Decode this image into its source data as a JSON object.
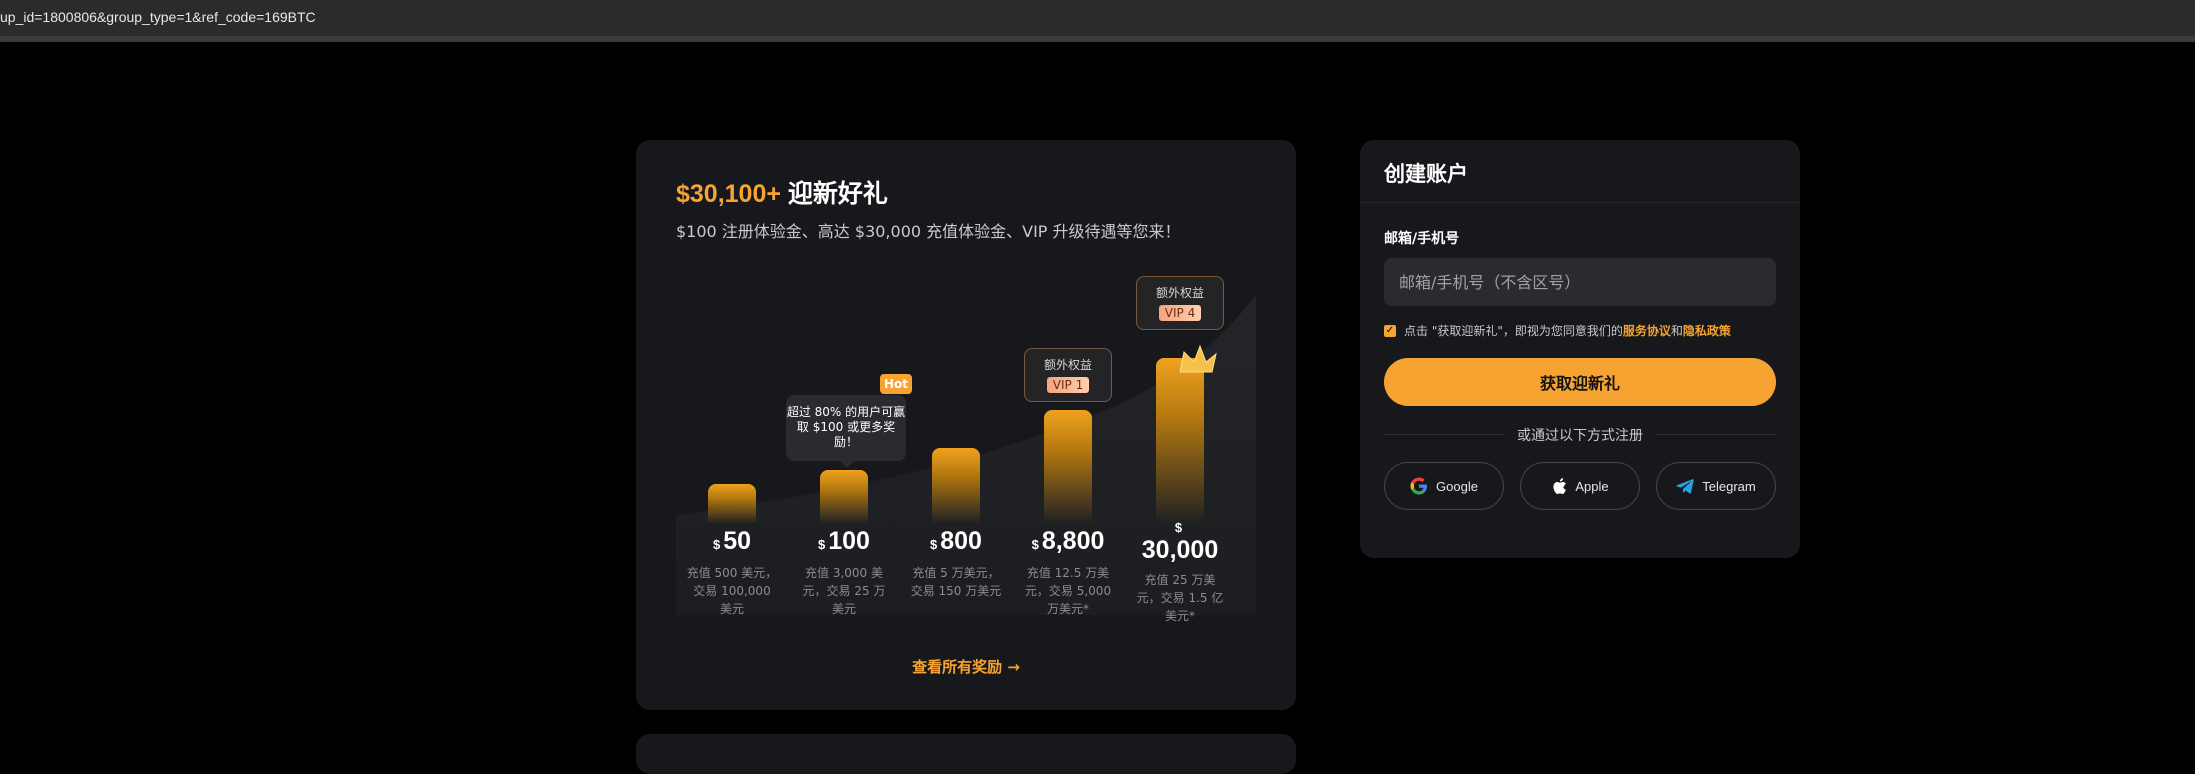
{
  "browser": {
    "url_fragment": "up_id=1800806&group_type=1&ref_code=169BTC"
  },
  "promo": {
    "title_amount": "$30,100+",
    "title_rest": " 迎新好礼",
    "subtitle": "$100 注册体验金、高达 $30,000 充值体验金、VIP 升级待遇等您来！",
    "hot_tooltip": "超过 80% 的用户可赢取 $100 或更多奖励！",
    "hot_badge": "Hot",
    "extra_label": "额外权益",
    "tiers": [
      {
        "currency": "$",
        "amount": "50",
        "desc": "充值 500 美元，交易 100,000 美元"
      },
      {
        "currency": "$",
        "amount": "100",
        "desc": "充值 3,000 美元，交易 25 万美元"
      },
      {
        "currency": "$",
        "amount": "800",
        "desc": "充值 5 万美元，交易 150 万美元"
      },
      {
        "currency": "$",
        "amount": "8,800",
        "desc": "充值 12.5 万美元，交易 5,000 万美元*"
      },
      {
        "currency": "$",
        "amount": "30,000",
        "desc": "充值 25 万美元，交易 1.5 亿美元*"
      }
    ],
    "vip_badges": [
      "VIP 1",
      "VIP 4"
    ],
    "view_all": "查看所有奖励 →"
  },
  "signup": {
    "title": "创建账户",
    "field_label": "邮箱/手机号",
    "field_placeholder": "邮箱/手机号（不含区号）",
    "agree_prefix": "点击 \"获取迎新礼\"，即视为您同意我们的",
    "terms_link": "服务协议",
    "and": "和",
    "privacy_link": "隐私政策",
    "cta": "获取迎新礼",
    "or_text": "或通过以下方式注册",
    "socials": [
      {
        "label": "Google",
        "icon": "google-icon"
      },
      {
        "label": "Apple",
        "icon": "apple-icon"
      },
      {
        "label": "Telegram",
        "icon": "telegram-icon"
      }
    ]
  },
  "colors": {
    "accent": "#f7a331",
    "card": "#17181b",
    "background": "#000000"
  }
}
